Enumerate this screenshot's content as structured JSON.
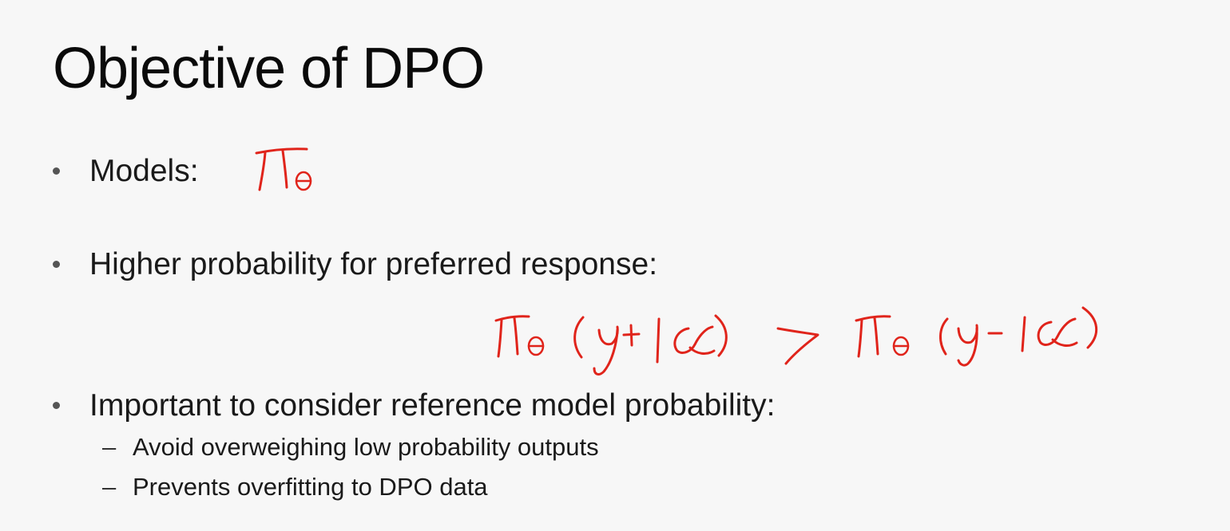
{
  "slide": {
    "title": "Objective of DPO",
    "bullets": [
      {
        "text": "Models:"
      },
      {
        "text": "Higher probability for preferred response:"
      },
      {
        "text": "Important to consider reference model probability:",
        "sub_items": [
          "Avoid overweighing low probability outputs",
          "Prevents overfitting to DPO data"
        ]
      }
    ]
  },
  "annotations": {
    "ink_color": "#e0241b",
    "pi_theta": "πθ",
    "inequality": "πθ (y+|x) > πθ (y-|x)"
  }
}
